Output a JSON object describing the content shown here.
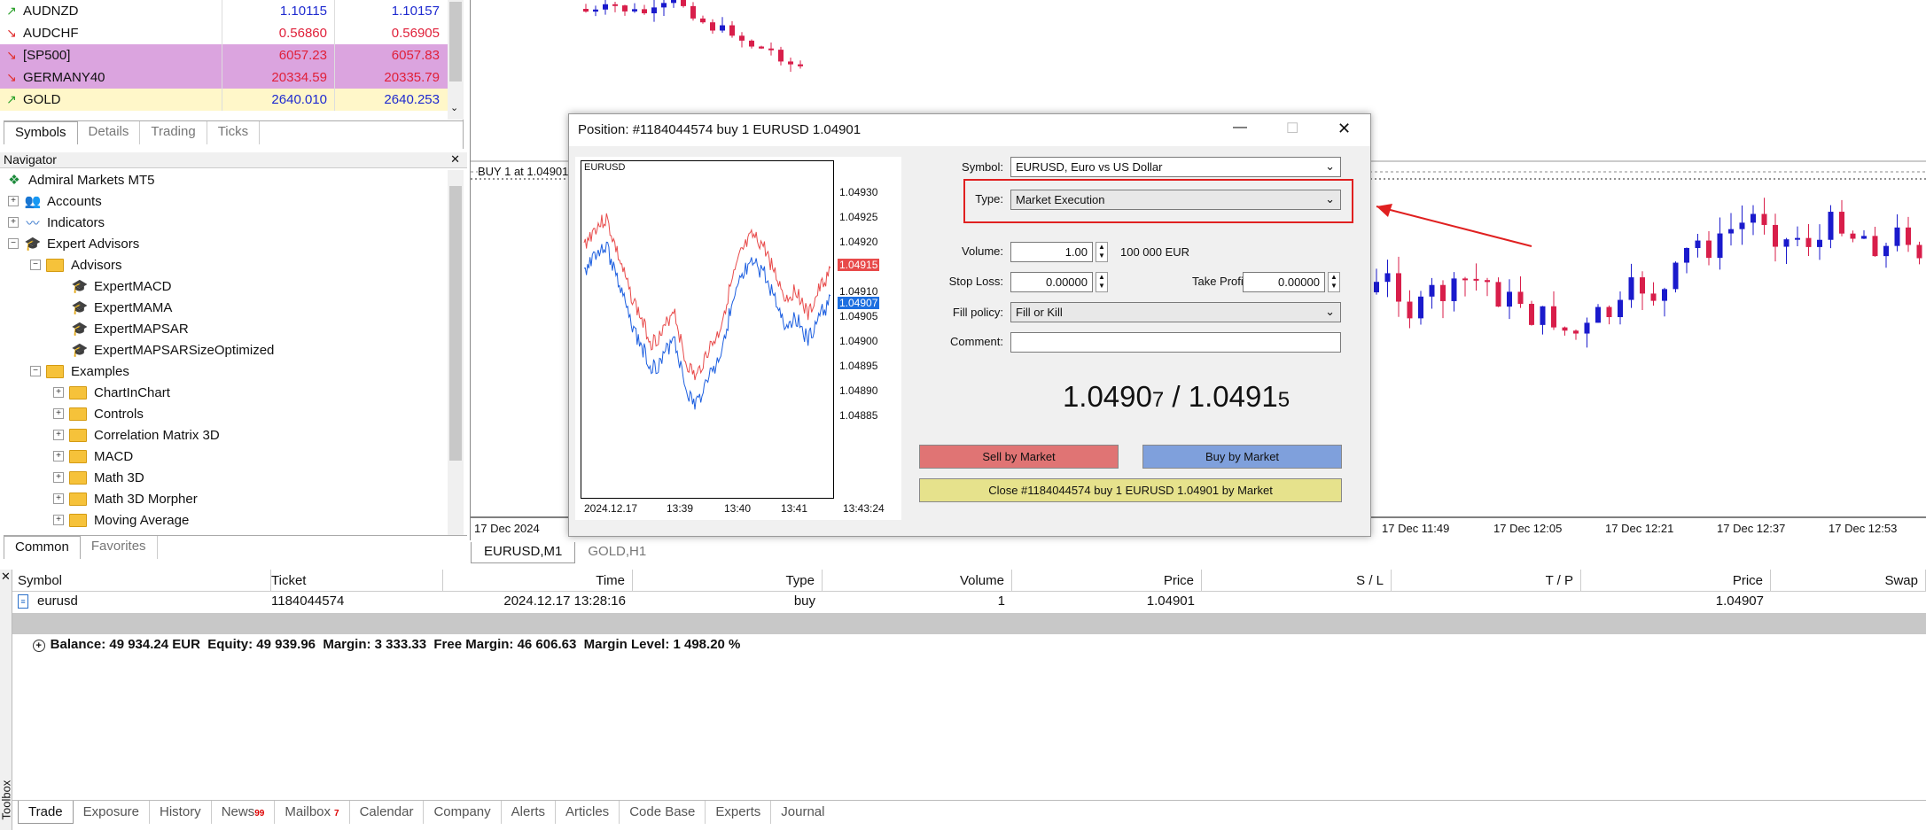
{
  "market_watch": {
    "rows": [
      {
        "symbol": "AUDNZD",
        "bid": "1.10115",
        "ask": "1.10157",
        "dir": "up"
      },
      {
        "symbol": "AUDCHF",
        "bid": "0.56860",
        "ask": "0.56905",
        "dir": "down"
      },
      {
        "symbol": "[SP500]",
        "bid": "6057.23",
        "ask": "6057.83",
        "dir": "down"
      },
      {
        "symbol": "GERMANY40",
        "bid": "20334.59",
        "ask": "20335.79",
        "dir": "down"
      },
      {
        "symbol": "GOLD",
        "bid": "2640.010",
        "ask": "2640.253",
        "dir": "up"
      }
    ],
    "tabs": [
      "Symbols",
      "Details",
      "Trading",
      "Ticks"
    ],
    "colors": {
      "up": "#2aa02a",
      "down": "#e03030",
      "bid_blue": "#1e2ad0",
      "bid_red": "#e0203a",
      "highlight": "#dba4df",
      "gold_bg": "#fff7c9"
    }
  },
  "navigator": {
    "title": "Navigator",
    "close": "✕",
    "root": "Admiral Markets MT5",
    "items": {
      "accounts": "Accounts",
      "indicators": "Indicators",
      "experts": "Expert Advisors",
      "advisors": "Advisors",
      "ea1": "ExpertMACD",
      "ea2": "ExpertMAMA",
      "ea3": "ExpertMAPSAR",
      "ea4": "ExpertMAPSARSizeOptimized",
      "examples": "Examples",
      "ex1": "ChartInChart",
      "ex2": "Controls",
      "ex3": "Correlation Matrix 3D",
      "ex4": "MACD",
      "ex5": "Math 3D",
      "ex6": "Math 3D Morpher",
      "ex7": "Moving Average"
    },
    "tabs": [
      "Common",
      "Favorites"
    ]
  },
  "chart": {
    "trade_line": "BUY 1 at 1.04901",
    "x_labels": [
      "17 Dec 2024",
      "17 Dec 11:49",
      "17 Dec 12:05",
      "17 Dec 12:21",
      "17 Dec 12:37",
      "17 Dec 12:53"
    ],
    "tabs": [
      "EURUSD,M1",
      "GOLD,H1"
    ]
  },
  "dialog": {
    "title": "Position: #1184044574 buy 1 EURUSD 1.04901",
    "minimize": "—",
    "maximize": "☐",
    "close": "✕",
    "mini_chart": {
      "symbol": "EURUSD",
      "y_labels": [
        "1.04930",
        "1.04925",
        "1.04920",
        "1.04915",
        "1.04910",
        "1.04905",
        "1.04900",
        "1.04895",
        "1.04890",
        "1.04885"
      ],
      "ask_tag": "1.04915",
      "bid_tag": "1.04907",
      "x_labels": [
        "2024.12.17",
        "13:39",
        "13:40",
        "13:41",
        "13:43:24"
      ]
    },
    "symbol_label": "Symbol:",
    "symbol_value": "EURUSD, Euro vs US Dollar",
    "type_label": "Type:",
    "type_value": "Market Execution",
    "volume_label": "Volume:",
    "volume_value": "1.00",
    "volume_unit": "100 000 EUR",
    "sl_label": "Stop Loss:",
    "sl_value": "0.00000",
    "tp_label": "Take Profit:",
    "tp_value": "0.00000",
    "fill_label": "Fill policy:",
    "fill_value": "Fill or Kill",
    "comment_label": "Comment:",
    "comment_value": "",
    "bid_main": "1.0490",
    "bid_small": "7",
    "sep": " / ",
    "ask_main": "1.0491",
    "ask_small": "5",
    "sell_btn": "Sell by Market",
    "buy_btn": "Buy by Market",
    "close_btn": "Close #1184044574 buy 1 EURUSD 1.04901 by Market"
  },
  "toolbox": {
    "side_label": "Toolbox",
    "close": "✕",
    "headers": {
      "symbol": "Symbol",
      "ticket": "Ticket",
      "time": "Time",
      "type": "Type",
      "volume": "Volume",
      "price": "Price",
      "sl": "S / L",
      "tp": "T / P",
      "price2": "Price",
      "swap": "Swap"
    },
    "row": {
      "symbol": "eurusd",
      "ticket": "1184044574",
      "time": "2024.12.17 13:28:16",
      "type": "buy",
      "volume": "1",
      "price": "1.04901",
      "price2": "1.04907"
    },
    "summary": "Balance: 49 934.24 EUR  Equity: 49 939.96  Margin: 3 333.33  Free Margin: 46 606.63  Margin Level: 1 498.20 %",
    "tabs": [
      {
        "label": "Trade",
        "badge": ""
      },
      {
        "label": "Exposure",
        "badge": ""
      },
      {
        "label": "History",
        "badge": ""
      },
      {
        "label": "News",
        "badge": "99"
      },
      {
        "label": "Mailbox",
        "badge": "7"
      },
      {
        "label": "Calendar",
        "badge": ""
      },
      {
        "label": "Company",
        "badge": ""
      },
      {
        "label": "Alerts",
        "badge": ""
      },
      {
        "label": "Articles",
        "badge": ""
      },
      {
        "label": "Code Base",
        "badge": ""
      },
      {
        "label": "Experts",
        "badge": ""
      },
      {
        "label": "Journal",
        "badge": ""
      }
    ]
  }
}
